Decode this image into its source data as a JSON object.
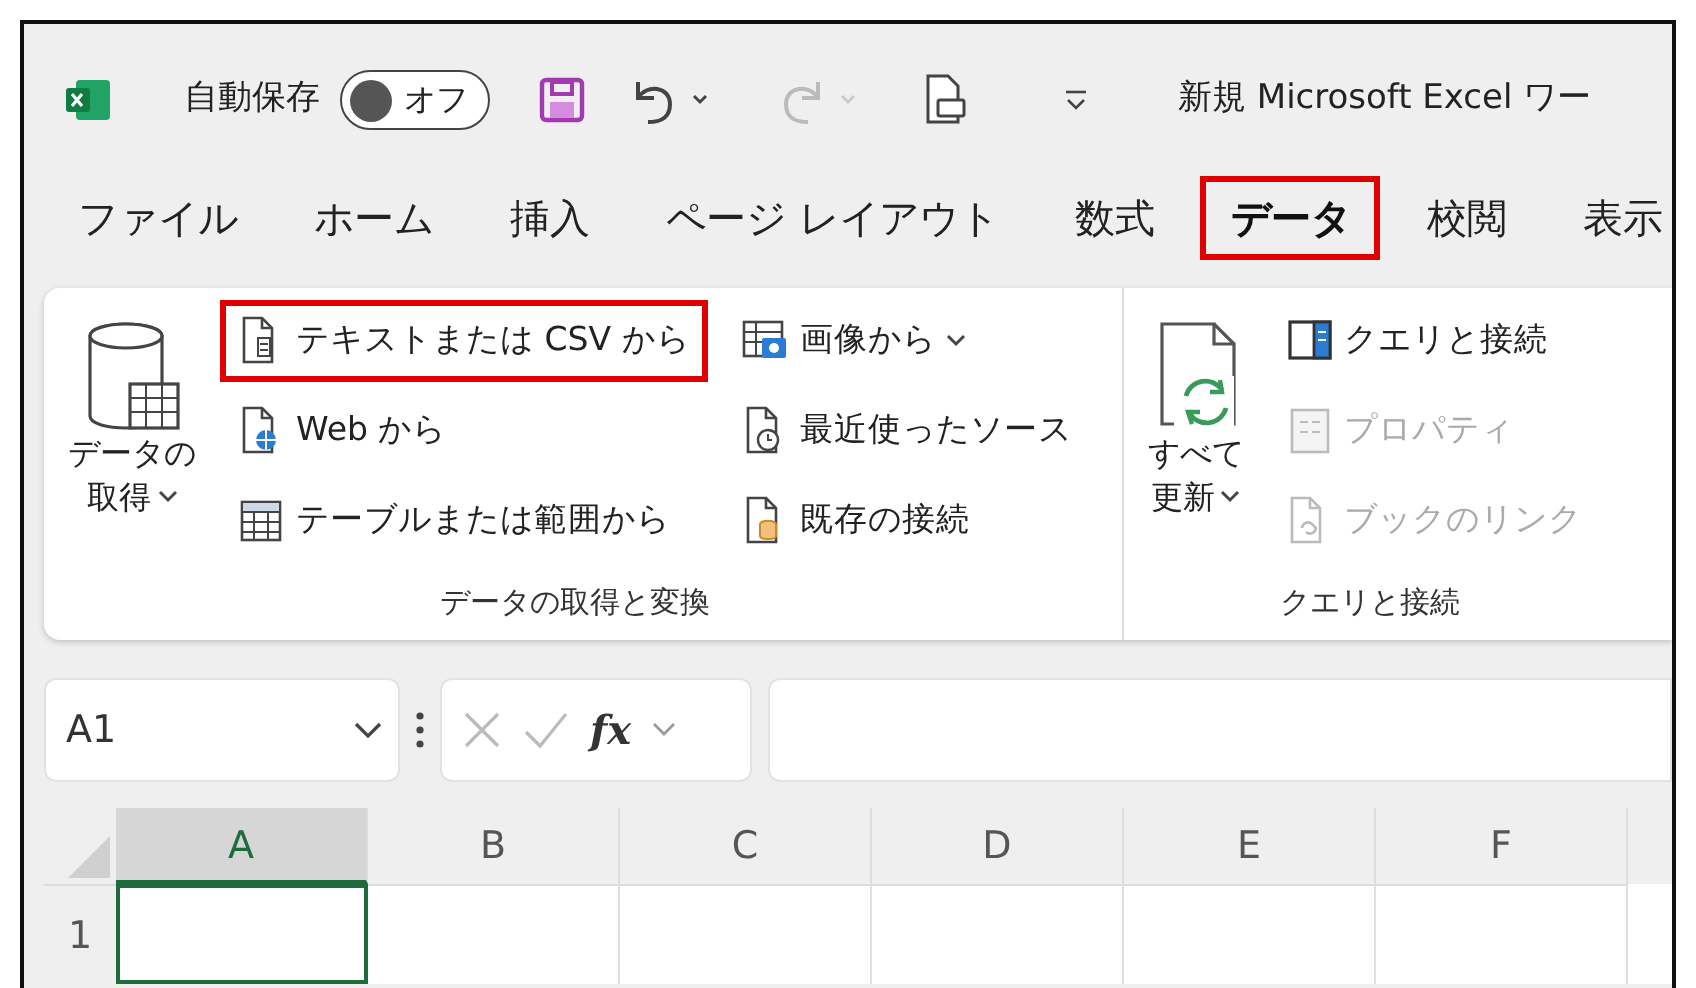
{
  "title_bar": {
    "autosave_label": "自動保存",
    "autosave_toggle": {
      "label": "オフ",
      "on": false
    },
    "title": "新規 Microsoft Excel ワー"
  },
  "tabs": [
    {
      "label": "ファイル",
      "selected": false,
      "highlighted": false
    },
    {
      "label": "ホーム",
      "selected": false,
      "highlighted": false
    },
    {
      "label": "挿入",
      "selected": false,
      "highlighted": false
    },
    {
      "label": "ページ レイアウト",
      "selected": false,
      "highlighted": false
    },
    {
      "label": "数式",
      "selected": false,
      "highlighted": false
    },
    {
      "label": "データ",
      "selected": true,
      "highlighted": true
    },
    {
      "label": "校閲",
      "selected": false,
      "highlighted": false
    },
    {
      "label": "表示",
      "selected": false,
      "highlighted": false
    }
  ],
  "ribbon": {
    "groups": [
      {
        "label": "データの取得と変換",
        "big_button": {
          "lines": [
            "データの",
            "取得"
          ],
          "dropdown": true
        },
        "columns": [
          [
            {
              "label": "テキストまたは CSV から",
              "dropdown": false,
              "disabled": false,
              "highlighted": true
            },
            {
              "label": "Web から",
              "dropdown": false,
              "disabled": false,
              "highlighted": false
            },
            {
              "label": "テーブルまたは範囲から",
              "dropdown": false,
              "disabled": false,
              "highlighted": false
            }
          ],
          [
            {
              "label": "画像から",
              "dropdown": true,
              "disabled": false,
              "highlighted": false
            },
            {
              "label": "最近使ったソース",
              "dropdown": false,
              "disabled": false,
              "highlighted": false
            },
            {
              "label": "既存の接続",
              "dropdown": false,
              "disabled": false,
              "highlighted": false
            }
          ]
        ]
      },
      {
        "label": "クエリと接続",
        "big_button": {
          "lines": [
            "すべて",
            "更新"
          ],
          "dropdown": true
        },
        "columns": [
          [
            {
              "label": "クエリと接続",
              "dropdown": false,
              "disabled": false,
              "highlighted": false
            },
            {
              "label": "プロパティ",
              "dropdown": false,
              "disabled": true,
              "highlighted": false
            },
            {
              "label": "ブックのリンク",
              "dropdown": false,
              "disabled": true,
              "highlighted": false
            }
          ]
        ]
      }
    ]
  },
  "formula_bar": {
    "name_box": "A1",
    "function_label": "fx"
  },
  "sheet": {
    "columns": [
      {
        "label": "A",
        "selected": true
      },
      {
        "label": "B",
        "selected": false
      },
      {
        "label": "C",
        "selected": false
      },
      {
        "label": "D",
        "selected": false
      },
      {
        "label": "E",
        "selected": false
      },
      {
        "label": "F",
        "selected": false
      }
    ],
    "rows": [
      {
        "label": "1",
        "cells": [
          {
            "active": true
          },
          {
            "active": false
          },
          {
            "active": false
          },
          {
            "active": false
          },
          {
            "active": false
          },
          {
            "active": false
          }
        ]
      }
    ]
  }
}
